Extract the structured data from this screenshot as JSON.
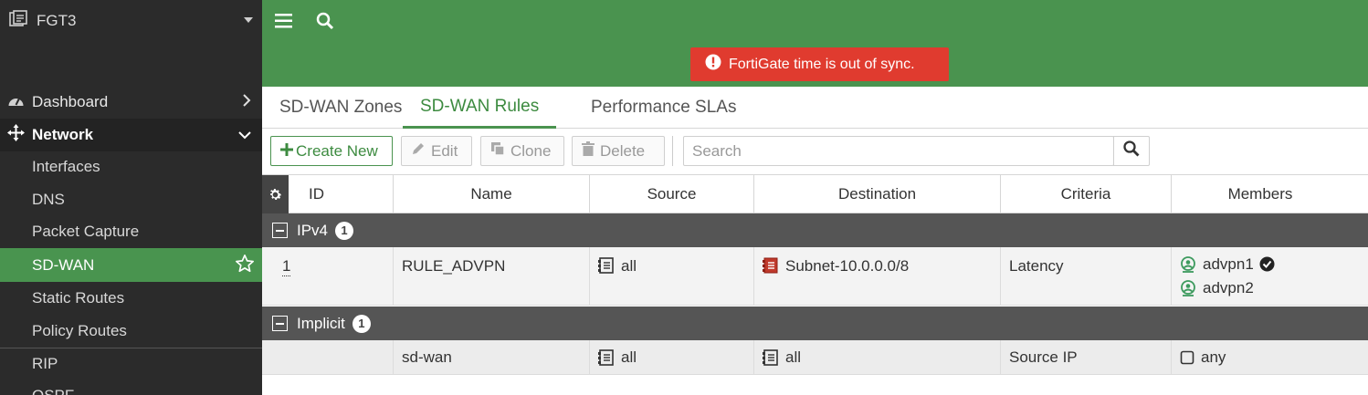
{
  "device": {
    "name": "FGT3"
  },
  "sidebar": {
    "items": [
      {
        "label": "Dashboard"
      },
      {
        "label": "Network"
      },
      {
        "label": "Interfaces"
      },
      {
        "label": "DNS"
      },
      {
        "label": "Packet Capture"
      },
      {
        "label": "SD-WAN"
      },
      {
        "label": "Static Routes"
      },
      {
        "label": "Policy Routes"
      },
      {
        "label": "RIP"
      },
      {
        "label": "OSPF"
      }
    ]
  },
  "alert": {
    "text": "FortiGate time is out of sync."
  },
  "tabs": [
    {
      "label": "SD-WAN Zones"
    },
    {
      "label": "SD-WAN Rules"
    },
    {
      "label": "Performance SLAs"
    }
  ],
  "toolbar": {
    "create_label": "Create New",
    "edit_label": "Edit",
    "clone_label": "Clone",
    "delete_label": "Delete",
    "search_placeholder": "Search"
  },
  "table": {
    "columns": [
      "ID",
      "Name",
      "Source",
      "Destination",
      "Criteria",
      "Members"
    ],
    "groups": [
      {
        "name": "IPv4",
        "count": "1",
        "rows": [
          {
            "id": "1",
            "name": "RULE_ADVPN",
            "source": "all",
            "destination": "Subnet-10.0.0.0/8",
            "criteria": "Latency",
            "members": [
              "advpn1",
              "advpn2"
            ]
          }
        ]
      },
      {
        "name": "Implicit",
        "count": "1",
        "rows": [
          {
            "id": "",
            "name": "sd-wan",
            "source": "all",
            "destination": "all",
            "criteria": "Source IP",
            "members": [
              "any"
            ]
          }
        ]
      }
    ]
  },
  "colors": {
    "accent": "#4a934f",
    "alert": "#e03b2f",
    "sidebar": "#2b2b2b",
    "group": "#555555"
  }
}
